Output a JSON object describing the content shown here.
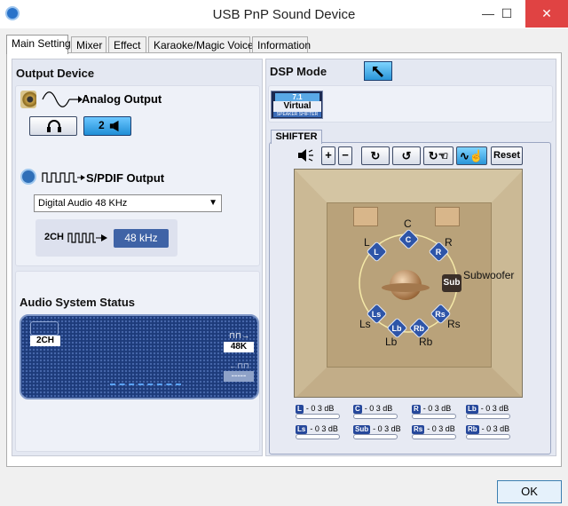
{
  "window": {
    "title": "USB PnP Sound Device",
    "minimize_icon": "minimize-icon",
    "maximize_icon": "maximize-icon",
    "close_icon": "close-icon"
  },
  "tabs": [
    {
      "label": "Main Setting",
      "active": true
    },
    {
      "label": "Mixer"
    },
    {
      "label": "Effect"
    },
    {
      "label": "Karaoke/Magic Voice"
    },
    {
      "label": "Information"
    }
  ],
  "output_device": {
    "heading": "Output Device",
    "analog_label": "Analog Output",
    "analog_buttons": [
      {
        "icon": "headphones-icon"
      },
      {
        "label": "2",
        "icon": "speaker-icon",
        "active": true
      }
    ],
    "spdif_label": "S/PDIF Output",
    "spdif_select": "Digital Audio 48 KHz",
    "pcm_label": "2CH",
    "khz_badge": "48 kHz"
  },
  "audio_status": {
    "heading": "Audio System Status",
    "channels": "2CH",
    "input_rate": "48K",
    "output_rate": "-----"
  },
  "dsp": {
    "heading": "DSP Mode",
    "virtual_top": "7.1",
    "virtual_mid": "Virtual",
    "virtual_bot": "SPEAKER SHIFTER",
    "shifter_tab": "SHIFTER",
    "reset_label": "Reset"
  },
  "room": {
    "labels": {
      "c": "C",
      "l": "L",
      "r": "R",
      "sub": "Subwoofer",
      "ls": "Ls",
      "rs": "Rs",
      "lb": "Lb",
      "rb": "Rb"
    },
    "channels": {
      "l": "L",
      "c": "C",
      "r": "R",
      "sub": "Sub",
      "ls": "Ls",
      "lb": "Lb",
      "rb": "Rb",
      "rs": "Rs"
    }
  },
  "meters": [
    {
      "tag": "L",
      "value": "- 0 3 dB"
    },
    {
      "tag": "C",
      "value": "- 0 3 dB"
    },
    {
      "tag": "R",
      "value": "- 0 3 dB"
    },
    {
      "tag": "Lb",
      "value": "- 0 3 dB"
    },
    {
      "tag": "Ls",
      "value": "- 0 3 dB"
    },
    {
      "tag": "Sub",
      "value": "- 0 3 dB"
    },
    {
      "tag": "Rs",
      "value": "- 0 3 dB"
    },
    {
      "tag": "Rb",
      "value": "- 0 3 dB"
    }
  ],
  "ok_label": "OK"
}
